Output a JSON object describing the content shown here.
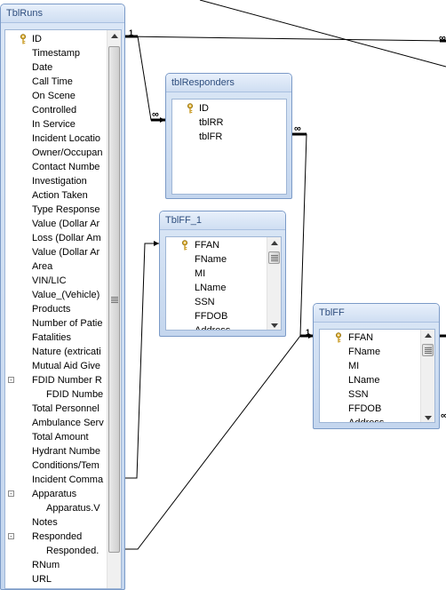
{
  "tables": {
    "tblRuns": {
      "title": "TblRuns",
      "fields": [
        {
          "label": "ID",
          "key": true
        },
        {
          "label": "Timestamp"
        },
        {
          "label": "Date"
        },
        {
          "label": "Call Time"
        },
        {
          "label": "On Scene"
        },
        {
          "label": "Controlled"
        },
        {
          "label": "In Service"
        },
        {
          "label": "Incident Locatio"
        },
        {
          "label": "Owner/Occupan"
        },
        {
          "label": "Contact Numbe"
        },
        {
          "label": "Investigation"
        },
        {
          "label": "Action Taken"
        },
        {
          "label": "Type Response"
        },
        {
          "label": "Value (Dollar Ar"
        },
        {
          "label": "Loss (Dollar Am"
        },
        {
          "label": "Value (Dollar Ar"
        },
        {
          "label": "Area"
        },
        {
          "label": "VIN/LIC"
        },
        {
          "label": "Value_(Vehicle)"
        },
        {
          "label": "Products"
        },
        {
          "label": "Number of Patie"
        },
        {
          "label": "Fatalities"
        },
        {
          "label": "Nature (extricati"
        },
        {
          "label": "Mutual Aid Give"
        },
        {
          "label": "FDID Number R",
          "expander": "-"
        },
        {
          "label": "FDID Numbe",
          "indent": true
        },
        {
          "label": "Total Personnel"
        },
        {
          "label": "Ambulance Serv"
        },
        {
          "label": "Total Amount"
        },
        {
          "label": "Hydrant Numbe"
        },
        {
          "label": "Conditions/Tem"
        },
        {
          "label": "Incident Comma"
        },
        {
          "label": "Apparatus",
          "expander": "-"
        },
        {
          "label": "Apparatus.V",
          "indent": true
        },
        {
          "label": "Notes"
        },
        {
          "label": "Responded",
          "expander": "-"
        },
        {
          "label": "Responded.",
          "indent": true
        },
        {
          "label": "RNum"
        },
        {
          "label": "URL"
        }
      ]
    },
    "tblResponders": {
      "title": "tblResponders",
      "fields": [
        {
          "label": "ID",
          "key": true
        },
        {
          "label": "tblRR"
        },
        {
          "label": "tblFR"
        }
      ]
    },
    "tblFF_1": {
      "title": "TblFF_1",
      "fields": [
        {
          "label": "FFAN",
          "key": true
        },
        {
          "label": "FName"
        },
        {
          "label": "MI"
        },
        {
          "label": "LName"
        },
        {
          "label": "SSN"
        },
        {
          "label": "FFDOB"
        },
        {
          "label": "Address"
        }
      ]
    },
    "tblFF": {
      "title": "TblFF",
      "fields": [
        {
          "label": "FFAN",
          "key": true
        },
        {
          "label": "FName"
        },
        {
          "label": "MI"
        },
        {
          "label": "LName"
        },
        {
          "label": "SSN"
        },
        {
          "label": "FFDOB"
        },
        {
          "label": "Address"
        }
      ]
    }
  },
  "relationships": {
    "one_label": "1",
    "many_label": "∞"
  },
  "colors": {
    "title_text": "#2e4e7e",
    "table_border": "#7b9ac7",
    "line": "#000000"
  }
}
